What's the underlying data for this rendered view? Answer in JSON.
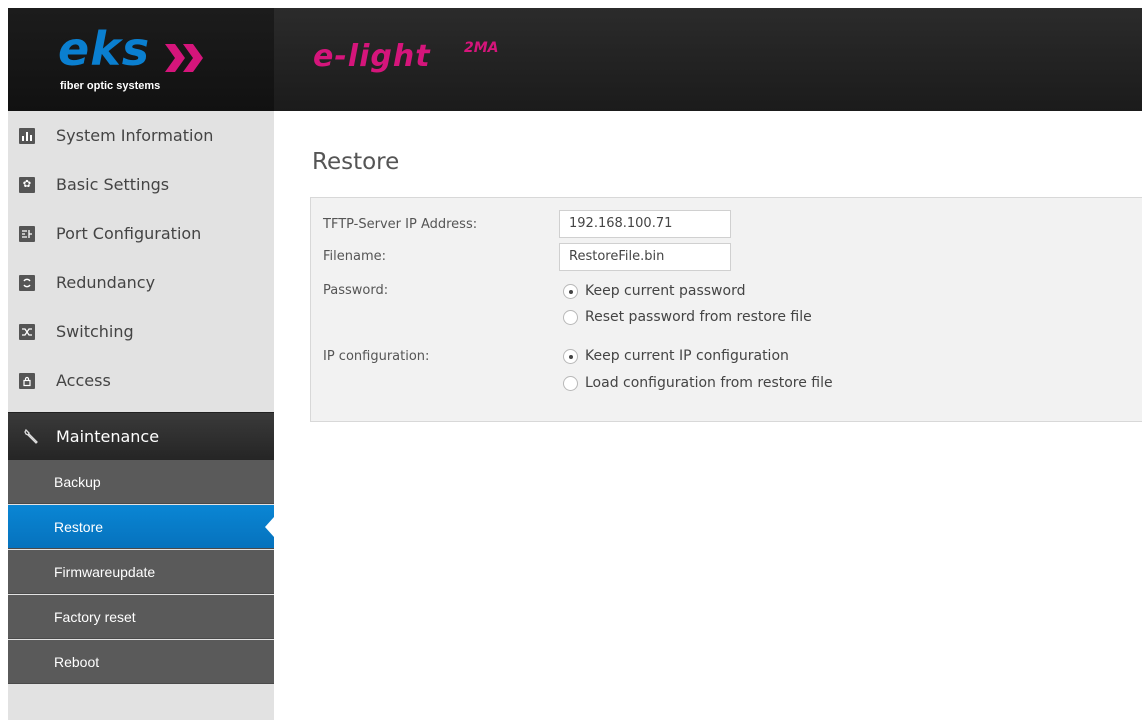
{
  "header": {
    "logo_text": "eks",
    "logo_tagline": "fiber optic systems",
    "product_name": "e-light",
    "product_suffix": "2MA",
    "colors": {
      "logo": "#0a7fd0",
      "product": "#d5157b",
      "header_bg": "#1e1e1e"
    }
  },
  "sidebar": {
    "items": [
      {
        "label": "System Information",
        "icon": "bar-chart-icon"
      },
      {
        "label": "Basic Settings",
        "icon": "gear-icon"
      },
      {
        "label": "Port Configuration",
        "icon": "port-config-icon"
      },
      {
        "label": "Redundancy",
        "icon": "redundancy-icon"
      },
      {
        "label": "Switching",
        "icon": "shuffle-icon"
      },
      {
        "label": "Access",
        "icon": "lock-icon"
      }
    ],
    "section": {
      "label": "Maintenance",
      "icon": "wrench-icon"
    },
    "sub_items": [
      {
        "label": "Backup",
        "active": false
      },
      {
        "label": "Restore",
        "active": true
      },
      {
        "label": "Firmwareupdate",
        "active": false
      },
      {
        "label": "Factory reset",
        "active": false
      },
      {
        "label": "Reboot",
        "active": false
      }
    ],
    "colors": {
      "active": "#0a86d4",
      "submenu": "#5a5a5a"
    }
  },
  "main": {
    "title": "Restore",
    "form": {
      "tftp_label": "TFTP-Server IP Address:",
      "tftp_value": "192.168.100.71",
      "filename_label": "Filename:",
      "filename_value": "RestoreFile.bin",
      "password_label": "Password:",
      "password_options": [
        {
          "label": "Keep current password",
          "checked": true
        },
        {
          "label": "Reset password from restore file",
          "checked": false
        }
      ],
      "ipconfig_label": "IP configuration:",
      "ipconfig_options": [
        {
          "label": "Keep current IP configuration",
          "checked": true
        },
        {
          "label": "Load configuration from restore file",
          "checked": false
        }
      ]
    }
  }
}
